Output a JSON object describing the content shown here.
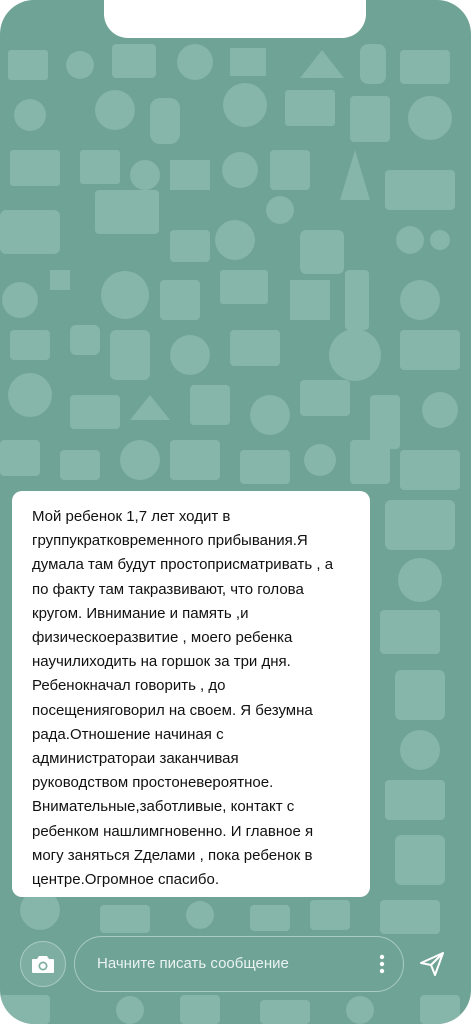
{
  "chat": {
    "message_lines": [
      "Мой ребенок 1,7 лет ходит в",
      "группукратковременного прибывания.Я",
      "думала там будут простоприсматривать , а",
      "по факту там такразвивают, что голова",
      "кругом. Ивнимание и память ,и",
      "физическоеразвитие , моего ребенка",
      "научилиходить на горшок за три дня.",
      "Ребенокначал говорить , до",
      "посещенияговорил на своем. Я безумна",
      "рада.Отношение начиная с",
      "администраторaи заканчивая",
      "руководством простоневероятное.",
      "Внимательные,заботливые, контакт с",
      "ребенком нашлимгновенно. И главное я",
      "могу заняться Zделами , пока ребенок в",
      "центре.Огромное спасибо."
    ]
  },
  "composer": {
    "placeholder": "Начните писать сообщение",
    "camera_icon": "camera-icon",
    "more_icon": "more-vertical-icon",
    "send_icon": "send-icon"
  },
  "colors": {
    "background": "#6fa395",
    "bubble": "#ffffff",
    "pattern": "#86b5a9"
  }
}
